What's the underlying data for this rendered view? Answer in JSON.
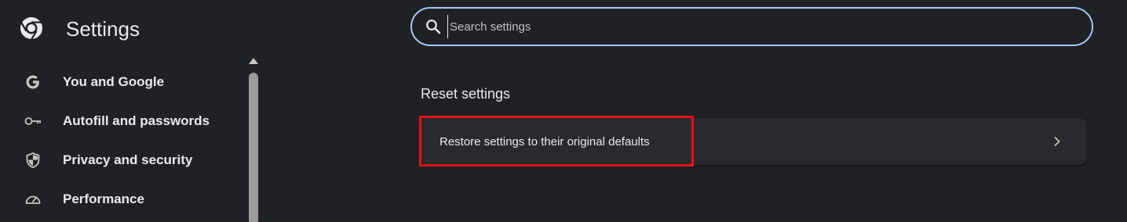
{
  "header": {
    "title": "Settings",
    "logo_icon": "chrome-logo-icon"
  },
  "search": {
    "placeholder": "Search settings",
    "value": "",
    "icon": "search-icon"
  },
  "sidebar": {
    "items": [
      {
        "label": "You and Google",
        "icon": "google-g-icon"
      },
      {
        "label": "Autofill and passwords",
        "icon": "key-icon"
      },
      {
        "label": "Privacy and security",
        "icon": "shield-icon"
      },
      {
        "label": "Performance",
        "icon": "speedometer-icon"
      }
    ]
  },
  "main": {
    "section_title": "Reset settings",
    "rows": [
      {
        "label": "Restore settings to their original defaults",
        "icon": "chevron-right-icon"
      }
    ]
  },
  "colors": {
    "background": "#202124",
    "card": "#292a2d",
    "search_border": "#a8c7fa",
    "highlight": "#e2141a",
    "text": "#e8eaed"
  }
}
